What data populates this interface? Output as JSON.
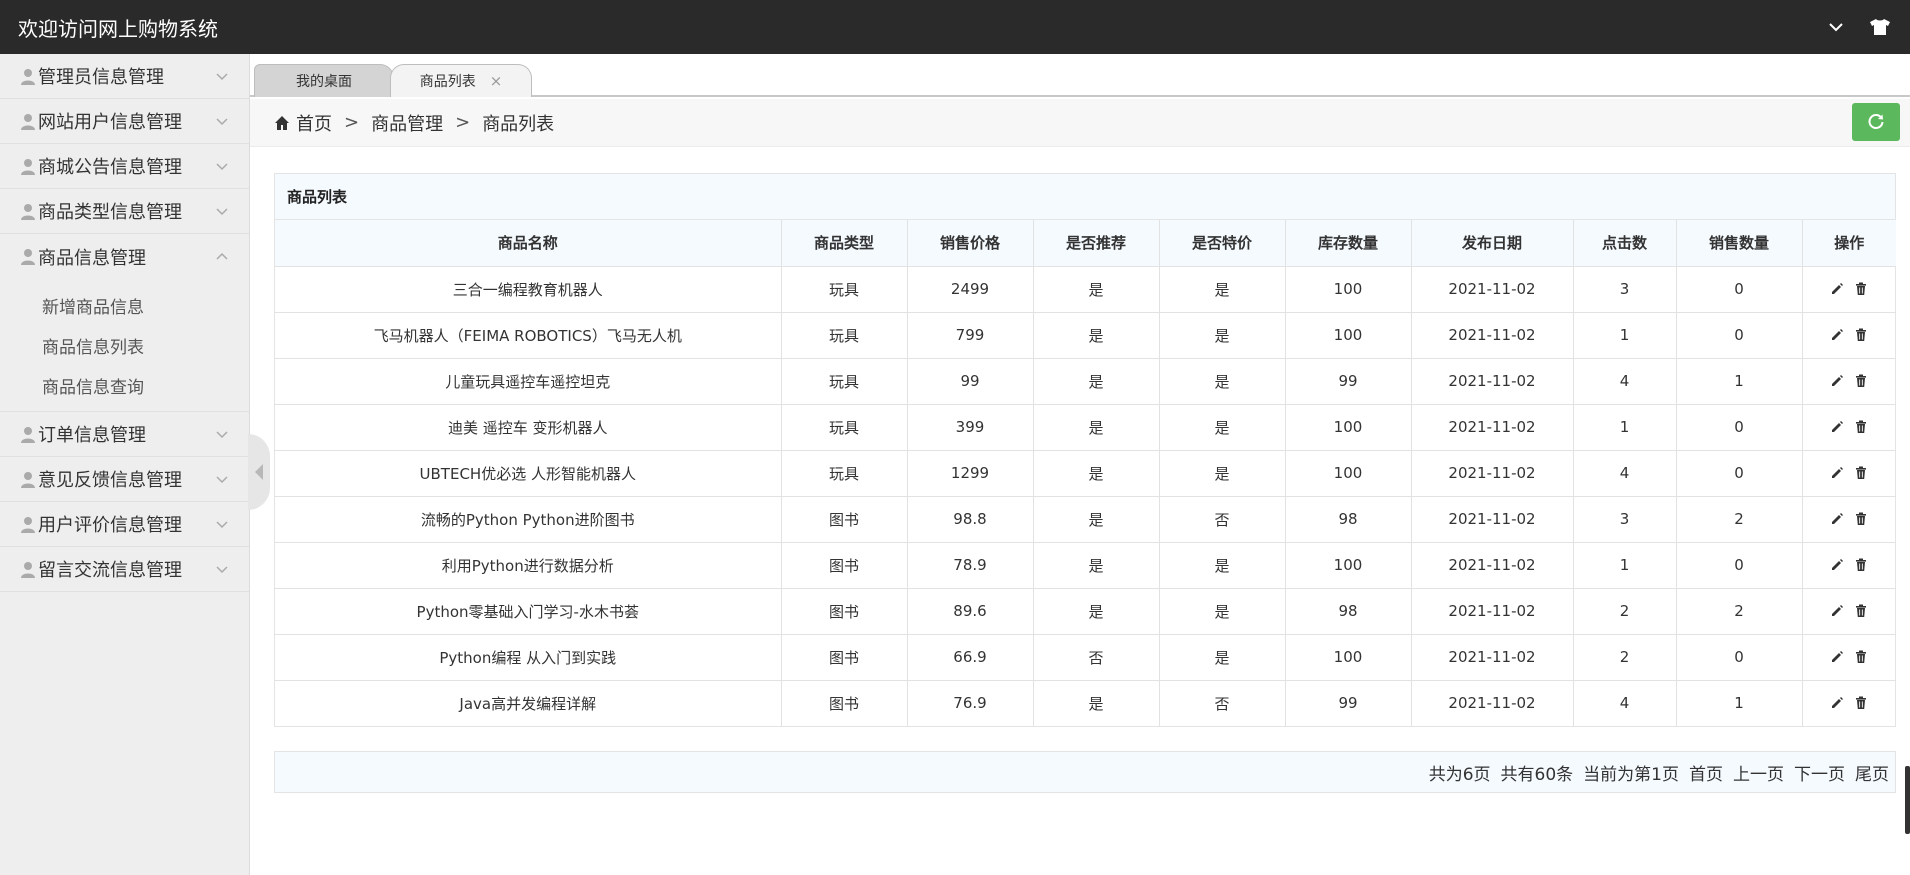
{
  "header": {
    "title": "欢迎访问网上购物系统"
  },
  "sidebar": {
    "items": [
      {
        "label": "管理员信息管理",
        "expanded": false
      },
      {
        "label": "网站用户信息管理",
        "expanded": false
      },
      {
        "label": "商城公告信息管理",
        "expanded": false
      },
      {
        "label": "商品类型信息管理",
        "expanded": false
      },
      {
        "label": "商品信息管理",
        "expanded": true
      },
      {
        "label": "订单信息管理",
        "expanded": false
      },
      {
        "label": "意见反馈信息管理",
        "expanded": false
      },
      {
        "label": "用户评价信息管理",
        "expanded": false
      },
      {
        "label": "留言交流信息管理",
        "expanded": false
      }
    ],
    "submenu": [
      "新增商品信息",
      "商品信息列表",
      "商品信息查询"
    ]
  },
  "tabs": [
    {
      "label": "我的桌面"
    },
    {
      "label": "商品列表",
      "close": "×"
    }
  ],
  "breadcrumb": {
    "home": "首页",
    "sep": ">",
    "level1": "商品管理",
    "level2": "商品列表"
  },
  "panel": {
    "title": "商品列表"
  },
  "table": {
    "headers": [
      "商品名称",
      "商品类型",
      "销售价格",
      "是否推荐",
      "是否特价",
      "库存数量",
      "发布日期",
      "点击数",
      "销售数量",
      "操作"
    ],
    "rows": [
      [
        "三合一编程教育机器人",
        "玩具",
        "2499",
        "是",
        "是",
        "100",
        "2021-11-02",
        "3",
        "0"
      ],
      [
        "飞马机器人（FEIMA ROBOTICS）飞马无人机",
        "玩具",
        "799",
        "是",
        "是",
        "100",
        "2021-11-02",
        "1",
        "0"
      ],
      [
        "儿童玩具遥控车遥控坦克",
        "玩具",
        "99",
        "是",
        "是",
        "99",
        "2021-11-02",
        "4",
        "1"
      ],
      [
        "迪美 遥控车 变形机器人",
        "玩具",
        "399",
        "是",
        "是",
        "100",
        "2021-11-02",
        "1",
        "0"
      ],
      [
        "UBTECH优必选 人形智能机器人",
        "玩具",
        "1299",
        "是",
        "是",
        "100",
        "2021-11-02",
        "4",
        "0"
      ],
      [
        "流畅的Python Python进阶图书",
        "图书",
        "98.8",
        "是",
        "否",
        "98",
        "2021-11-02",
        "3",
        "2"
      ],
      [
        "利用Python进行数据分析",
        "图书",
        "78.9",
        "是",
        "是",
        "100",
        "2021-11-02",
        "1",
        "0"
      ],
      [
        "Python零基础入门学习-水木书荟",
        "图书",
        "89.6",
        "是",
        "是",
        "98",
        "2021-11-02",
        "2",
        "2"
      ],
      [
        "Python编程 从入门到实践",
        "图书",
        "66.9",
        "否",
        "是",
        "100",
        "2021-11-02",
        "2",
        "0"
      ],
      [
        "Java高并发编程详解",
        "图书",
        "76.9",
        "是",
        "否",
        "99",
        "2021-11-02",
        "4",
        "1"
      ]
    ]
  },
  "pager": {
    "total_pages": "共为6页",
    "total_items": "共有60条",
    "current": "当前为第1页",
    "first": "首页",
    "prev": "上一页",
    "next": "下一页",
    "last": "尾页"
  },
  "icons": {
    "top_right": [
      "chevron-down-icon",
      "shirt-icon"
    ],
    "menu": "user-icon",
    "breadcrumb": "home-icon",
    "refresh": "refresh-icon",
    "row_ops": [
      "edit-icon",
      "delete-icon"
    ]
  },
  "colors": {
    "topbar": "#2a2a2a",
    "refresh_button": "#5cb85c",
    "sidebar": "#eeeeee",
    "header_row": "#f5faff"
  }
}
